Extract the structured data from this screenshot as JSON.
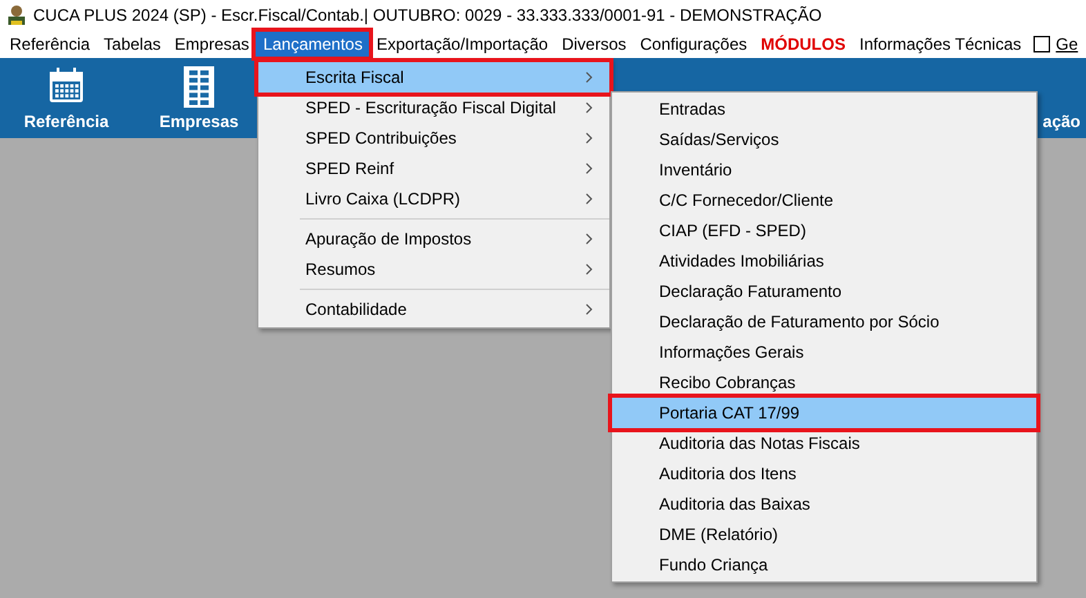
{
  "window": {
    "title": "CUCA PLUS 2024 (SP) - Escr.Fiscal/Contab.| OUTUBRO: 0029 - 33.333.333/0001-91 - DEMONSTRAÇÃO"
  },
  "menu_bar": [
    {
      "label": "Referência",
      "kind": "item",
      "selected": false
    },
    {
      "label": "Tabelas",
      "kind": "item",
      "selected": false
    },
    {
      "label": "Empresas",
      "kind": "item",
      "selected": false
    },
    {
      "label": "Lançamentos",
      "kind": "item",
      "selected": true
    },
    {
      "label": "Exportação/Importação",
      "kind": "item",
      "selected": false
    },
    {
      "label": "Diversos",
      "kind": "item",
      "selected": false
    },
    {
      "label": "Configurações",
      "kind": "item",
      "selected": false
    },
    {
      "label": "MÓDULOS",
      "kind": "alert",
      "selected": false
    },
    {
      "label": "Informações Técnicas",
      "kind": "item",
      "selected": false
    },
    {
      "label": "Ge",
      "kind": "checkbox",
      "checked": false
    }
  ],
  "toolbar": [
    {
      "label": "Referência",
      "kind": "calendar"
    },
    {
      "label": "Empresas",
      "kind": "building"
    },
    {
      "label": "ação",
      "kind": "partial"
    }
  ],
  "menu": [
    [
      {
        "label": "Escrita Fiscal",
        "selected": true
      },
      {
        "label": "SPED - Escrituração Fiscal Digital",
        "selected": false
      },
      {
        "label": "SPED Contribuições",
        "selected": false
      },
      {
        "label": "SPED Reinf",
        "selected": false
      },
      {
        "label": "Livro Caixa (LCDPR)",
        "selected": false
      }
    ],
    [
      {
        "label": "Apuração de Impostos",
        "selected": false
      },
      {
        "label": "Resumos",
        "selected": false
      }
    ],
    [
      {
        "label": "Contabilidade",
        "selected": false
      }
    ]
  ],
  "submenu": [
    {
      "label": "Entradas",
      "selected": false
    },
    {
      "label": "Saídas/Serviços",
      "selected": false
    },
    {
      "label": "Inventário",
      "selected": false
    },
    {
      "label": "C/C Fornecedor/Cliente",
      "selected": false
    },
    {
      "label": "CIAP (EFD - SPED)",
      "selected": false
    },
    {
      "label": "Atividades Imobiliárias",
      "selected": false
    },
    {
      "label": "Declaração Faturamento",
      "selected": false
    },
    {
      "label": "Declaração de Faturamento por Sócio",
      "selected": false
    },
    {
      "label": "Informações Gerais",
      "selected": false
    },
    {
      "label": "Recibo Cobranças",
      "selected": false
    },
    {
      "label": "Portaria CAT 17/99",
      "selected": true
    },
    {
      "label": "Auditoria das Notas Fiscais",
      "selected": false
    },
    {
      "label": "Auditoria dos Itens",
      "selected": false
    },
    {
      "label": "Auditoria das Baixas",
      "selected": false
    },
    {
      "label": "DME (Relatório)",
      "selected": false
    },
    {
      "label": "Fundo Criança",
      "selected": false
    }
  ]
}
